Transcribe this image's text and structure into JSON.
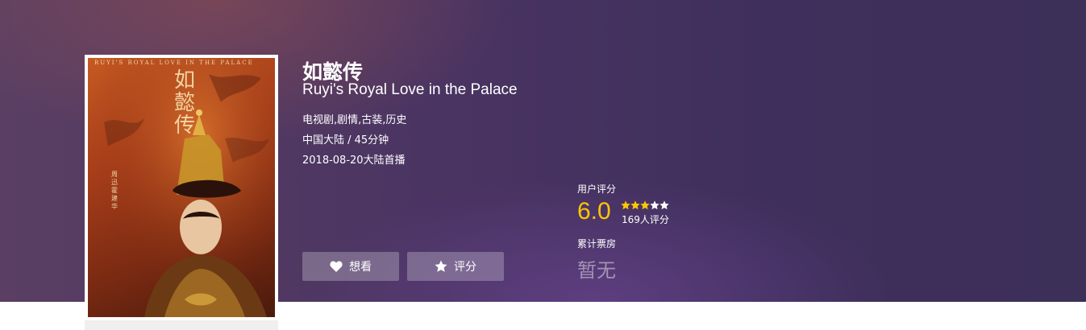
{
  "movie": {
    "title_cn": "如懿传",
    "title_en": "Ruyi's Royal Love in the Palace",
    "genres": "电视剧,剧情,古装,历史",
    "region_duration": "中国大陆 / 45分钟",
    "release": "2018-08-20大陆首播"
  },
  "poster": {
    "top_text": "RUYI'S ROYAL LOVE IN THE PALACE",
    "title_text": "如懿传",
    "credit_text": "周迅 霍建华"
  },
  "actions": {
    "want_label": "想看",
    "rate_label": "评分",
    "want_icon": "heart-icon",
    "rate_icon": "star-icon"
  },
  "rating": {
    "label": "用户评分",
    "score": "6.0",
    "stars_filled": 3,
    "stars_total": 5,
    "count": "169人评分"
  },
  "box_office": {
    "label": "累计票房",
    "value": "暂无"
  },
  "colors": {
    "score": "#ffc600",
    "star_filled": "#ffc600",
    "star_empty": "#ffffff"
  }
}
